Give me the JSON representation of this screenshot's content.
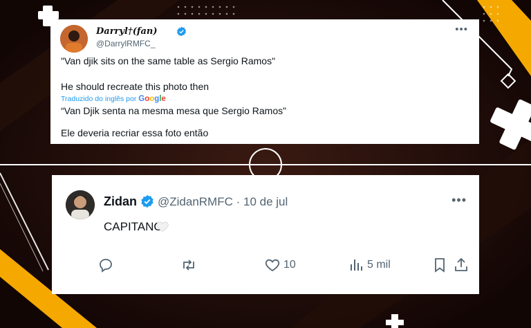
{
  "tweet1": {
    "name": "Darryl",
    "name_suffix": "(fan)",
    "handle": "@DarrylRMFC_",
    "original_line1": "\"Van djik sits on the same table as Sergio Ramos\"",
    "original_line2": "He should recreate this photo then",
    "translated_by": "Traduzido do inglês por",
    "google": "Google",
    "translated_line1": "“Van Djik senta na mesma mesa que Sergio Ramos”",
    "translated_line2": "Ele deveria recriar essa foto então"
  },
  "tweet2": {
    "name": "Zidan",
    "meta": "@ZidanRMFC · 10 de jul",
    "text": "CAPITANO",
    "likes": "10",
    "views": "5 mil"
  },
  "colors": {
    "accent_blue": "#1d9bf0",
    "background": "#160807",
    "stripe_yellow": "#f5a800"
  }
}
